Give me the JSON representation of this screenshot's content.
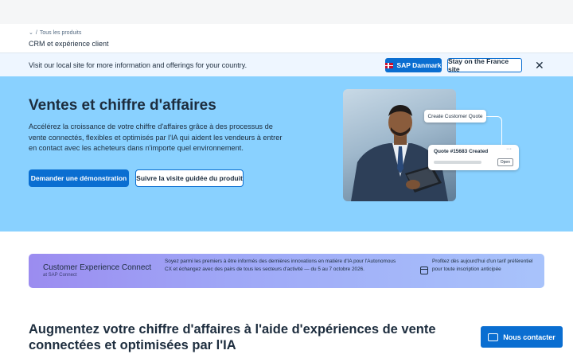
{
  "breadcrumb": {
    "parent": "Tous les produits",
    "separator": "/",
    "current": "CRM et expérience client"
  },
  "country_bar": {
    "message": "Visit our local site for more information and offerings for your country.",
    "local_button": "SAP Danmark",
    "stay_button": "Stay on the France site",
    "close": "✕"
  },
  "hero": {
    "title": "Ventes et chiffre d'affaires",
    "description": "Accélérez la croissance de votre chiffre d'affaires grâce à des processus de vente connectés, flexibles et optimisés par l'IA qui aident les vendeurs à entrer en contact avec les acheteurs dans n'importe quel environnement.",
    "primary_button": "Demander une démonstration",
    "secondary_button": "Suivre la visite guidée du produit",
    "card_action": "Create Customer Quote",
    "card_quote": "Quote #15683 Created",
    "card_open": "Open",
    "card_more": "···"
  },
  "event": {
    "title": "Customer Experience Connect",
    "subtitle": "at SAP Connect",
    "description": "Soyez parmi les premiers à être informés des dernières innovations en matière d'IA pour l'Autonomous CX et échangez avec des pairs de tous les secteurs d'activité — du 5 au 7 octobre 2026.",
    "cta": "Profitez dès aujourd'hui d'un tarif préférentiel pour toute inscription anticipée"
  },
  "section": {
    "title": "Augmentez votre chiffre d'affaires à l'aide d'expériences de vente connectées et optimisées par l'IA"
  },
  "contact": {
    "label": "Nous contacter"
  },
  "colors": {
    "accent": "#0a6ed1",
    "hero_bg": "#89d1ff",
    "country_bar_bg": "#eef6ff"
  }
}
